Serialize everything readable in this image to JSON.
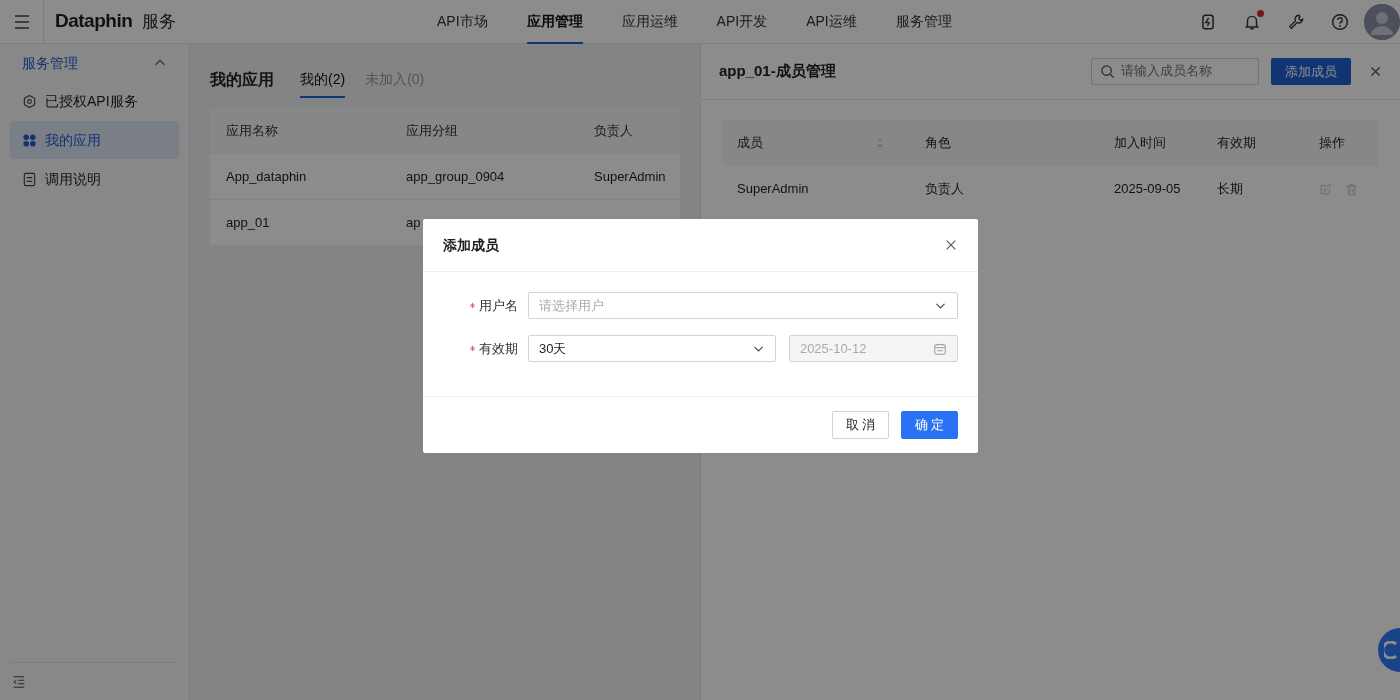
{
  "app": {
    "logo": "Dataphin",
    "product": "服务"
  },
  "top_nav": [
    {
      "label": "API市场",
      "selected": false
    },
    {
      "label": "应用管理",
      "selected": true
    },
    {
      "label": "应用运维",
      "selected": false
    },
    {
      "label": "API开发",
      "selected": false
    },
    {
      "label": "API运维",
      "selected": false
    },
    {
      "label": "服务管理",
      "selected": false
    }
  ],
  "header_icons": [
    {
      "unread": false
    },
    {
      "unread": true
    },
    {
      "unread": false
    },
    {
      "unread": false
    }
  ],
  "sidebar": {
    "group": {
      "label": "服务管理",
      "expanded": true
    },
    "items": [
      {
        "label": "已授权API服务",
        "selected": false
      },
      {
        "label": "我的应用",
        "selected": true
      },
      {
        "label": "调用说明",
        "selected": false
      }
    ]
  },
  "main": {
    "title": "我的应用",
    "tabs": [
      {
        "label": "我的(2)",
        "selected": true
      },
      {
        "label": "未加入(0)",
        "selected": false
      }
    ],
    "table": {
      "columns": [
        "应用名称",
        "应用分组",
        "负责人"
      ],
      "rows": [
        [
          "App_dataphin",
          "app_group_0904",
          "SuperAdmin"
        ],
        [
          "app_01",
          "ap"
        ]
      ]
    }
  },
  "member_panel": {
    "title": "app_01-成员管理",
    "search": {
      "placeholder": "请输入成员名称"
    },
    "add_button": "添加成员",
    "table": {
      "columns": [
        "成员",
        "角色",
        "加入时间",
        "有效期",
        "操作"
      ],
      "rows": [
        [
          "SuperAdmin",
          "负责人",
          "2025-09-05",
          "长期"
        ]
      ]
    }
  },
  "dialog": {
    "title": "添加成员",
    "fields": [
      {
        "label": "用户名",
        "required": true,
        "placeholder": "请选择用户"
      },
      {
        "label": "有效期",
        "required": true,
        "value": "30天",
        "date": {
          "value": "2025-10-12",
          "disabled": true
        }
      }
    ],
    "buttons": [
      {
        "label": "取 消",
        "kind": "secondary"
      },
      {
        "label": "确 定",
        "kind": "primary"
      }
    ]
  }
}
